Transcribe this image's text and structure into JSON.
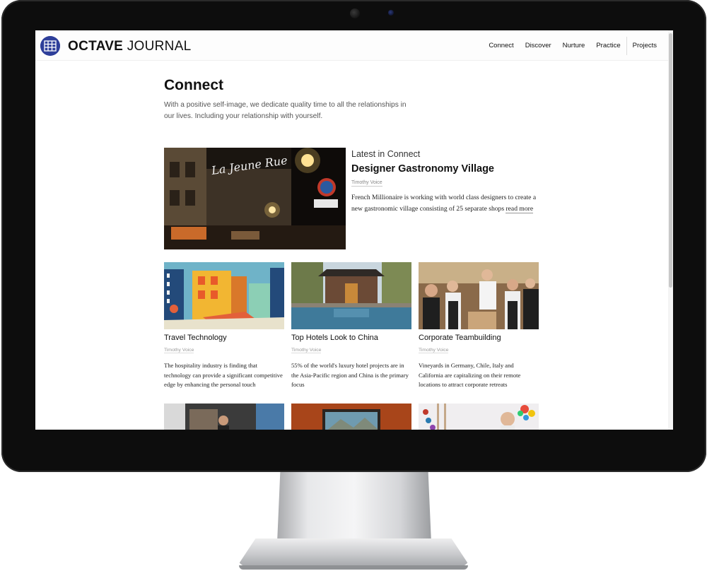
{
  "brand": {
    "name_bold": "OCTAVE",
    "name_light": "JOURNAL"
  },
  "nav": {
    "items": [
      "Connect",
      "Discover",
      "Nurture",
      "Practice",
      "Projects"
    ]
  },
  "page": {
    "title": "Connect",
    "intro": "With a positive self-image, we dedicate quality time to all the relationships in our lives. Including your relationship with yourself."
  },
  "feature": {
    "kicker": "Latest in Connect",
    "title": "Designer Gastronomy Village",
    "author": "Timothy Voice",
    "body": "French Millionaire is working with world class designers to create a new gastronomic village consisting of 25 separate shops ",
    "read_more": "read more",
    "image_sign_text": "La Jeune Rue"
  },
  "cards": [
    {
      "title": "Travel Technology",
      "author": "Timothy Voice",
      "desc": "The hospitality industry is finding that technology can provide a significant competitive edge by enhancing the personal touch"
    },
    {
      "title": "Top Hotels Look to China",
      "author": "Timothy Voice",
      "desc": "55% of the world's luxury hotel projects are in the Asia-Pacific region and China is the primary focus"
    },
    {
      "title": "Corporate Teambuilding",
      "author": "Timothy Voice",
      "desc": "Vineyards in Germany, Chile, Italy and California are capitalizing on their remote locations to attract corporate retreats"
    }
  ],
  "colors": {
    "brand_blue": "#2e3f9a",
    "text": "#111111",
    "muted": "#888888"
  },
  "icons": {
    "logo": "grid-globe-icon"
  }
}
